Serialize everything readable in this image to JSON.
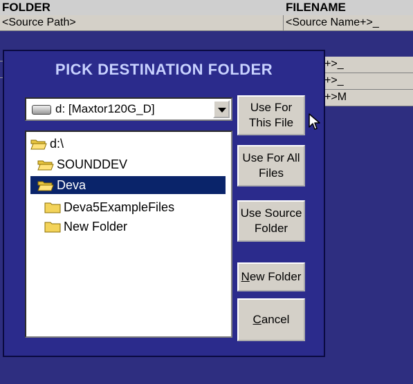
{
  "grid": {
    "headers": [
      "FOLDER",
      "FILENAME"
    ],
    "first_row": [
      "<Source Path>",
      "<Source Name+>_"
    ],
    "right_column_rows": [
      "e Name+>_",
      "e Name+>_",
      "e Name+>M"
    ]
  },
  "dialog": {
    "title": "PICK DESTINATION FOLDER",
    "drive_select": "d: [Maxtor120G_D]",
    "tree": [
      {
        "label": "d:\\",
        "selected": false
      },
      {
        "label": "SOUNDDEV",
        "selected": false
      },
      {
        "label": "Deva",
        "selected": true
      },
      {
        "label": "Deva5ExampleFiles",
        "selected": false
      },
      {
        "label": "New Folder",
        "selected": false
      }
    ],
    "buttons": {
      "use_for_this_file_1": "Use For",
      "use_for_this_file_2": "This File",
      "use_for_all_files_1": "Use For All",
      "use_for_all_files_2": "Files",
      "use_source_folder_1": "Use Source",
      "use_source_folder_2": "Folder",
      "new_folder_accel": "N",
      "new_folder_rest": "ew Folder",
      "cancel_accel": "C",
      "cancel_rest": "ancel"
    }
  },
  "icons": {
    "drive": "hard-drive-icon",
    "folder_open": "open-folder-icon",
    "folder_closed": "folder-icon",
    "cursor": "mouse-pointer-icon"
  },
  "colors": {
    "dialog_bg": "#2b2b8c",
    "title_text": "#c8d2ff",
    "selection": "#0a246a",
    "button_face": "#d4d0c8"
  }
}
